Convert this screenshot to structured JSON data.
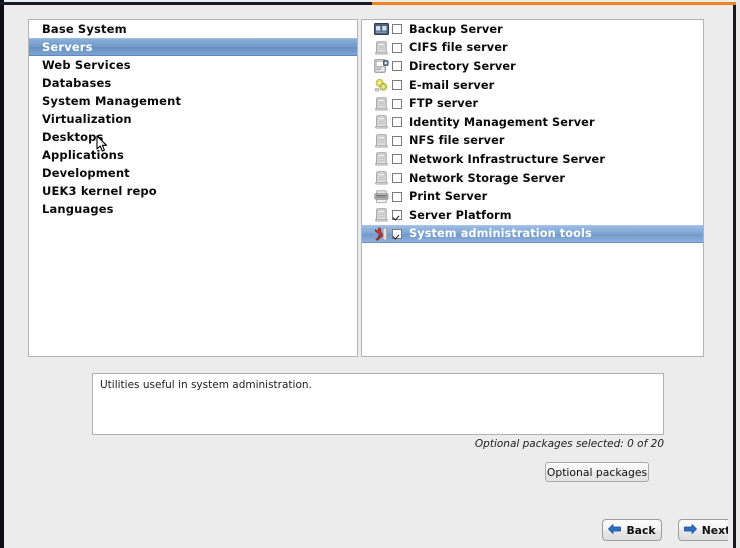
{
  "window": {
    "accent_orange": "#f4821f",
    "accent_dark": "#131c2b",
    "selection_blue": "#7099cc",
    "background": "#ececec"
  },
  "group_list": {
    "name": "package-group-list",
    "selected_index": 1,
    "items": [
      {
        "label": "Base System",
        "selected": false
      },
      {
        "label": "Servers",
        "selected": true
      },
      {
        "label": "Web Services",
        "selected": false
      },
      {
        "label": "Databases",
        "selected": false
      },
      {
        "label": "System Management",
        "selected": false
      },
      {
        "label": "Virtualization",
        "selected": false
      },
      {
        "label": "Desktops",
        "selected": false
      },
      {
        "label": "Applications",
        "selected": false
      },
      {
        "label": "Development",
        "selected": false
      },
      {
        "label": "UEK3 kernel repo",
        "selected": false
      },
      {
        "label": "Languages",
        "selected": false
      }
    ]
  },
  "package_list": {
    "name": "package-environment-list",
    "selected_index": 11,
    "items": [
      {
        "label": "Backup Server",
        "checked": false,
        "selected": false,
        "icon": "tape-drive-icon",
        "icon_color": "#5a6b84"
      },
      {
        "label": "CIFS file server",
        "checked": false,
        "selected": false,
        "icon": "server-tower-icon",
        "icon_color": "#c9c9c9"
      },
      {
        "label": "Directory Server",
        "checked": false,
        "selected": false,
        "icon": "directory-card-icon",
        "icon_color": "#d4d4d4"
      },
      {
        "label": "E-mail server",
        "checked": false,
        "selected": false,
        "icon": "mail-gear-icon",
        "icon_color": "#e8e07a"
      },
      {
        "label": "FTP server",
        "checked": false,
        "selected": false,
        "icon": "server-tower-icon",
        "icon_color": "#c9c9c9"
      },
      {
        "label": "Identity Management Server",
        "checked": false,
        "selected": false,
        "icon": "server-tower-icon",
        "icon_color": "#c9c9c9"
      },
      {
        "label": "NFS file server",
        "checked": false,
        "selected": false,
        "icon": "server-tower-icon",
        "icon_color": "#c9c9c9"
      },
      {
        "label": "Network Infrastructure Server",
        "checked": false,
        "selected": false,
        "icon": "server-tower-icon",
        "icon_color": "#c9c9c9"
      },
      {
        "label": "Network Storage Server",
        "checked": false,
        "selected": false,
        "icon": "server-tower-icon",
        "icon_color": "#c9c9c9"
      },
      {
        "label": "Print Server",
        "checked": false,
        "selected": false,
        "icon": "printer-icon",
        "icon_color": "#9a9a9a"
      },
      {
        "label": "Server Platform",
        "checked": true,
        "selected": false,
        "icon": "server-tower-icon",
        "icon_color": "#c9c9c9"
      },
      {
        "label": "System administration tools",
        "checked": true,
        "selected": true,
        "icon": "wrench-tools-icon",
        "icon_color": "#c8312c"
      }
    ]
  },
  "description": {
    "name": "group-description",
    "text": "Utilities useful in system administration.",
    "optional_status": "Optional packages selected: 0 of 20",
    "optional_button_label": "Optional packages"
  },
  "navigation": {
    "back_label": "Back",
    "next_label": "Next",
    "back_icon": "arrow-left-icon",
    "next_icon": "arrow-right-icon",
    "arrow_color": "#2a6fc4"
  }
}
